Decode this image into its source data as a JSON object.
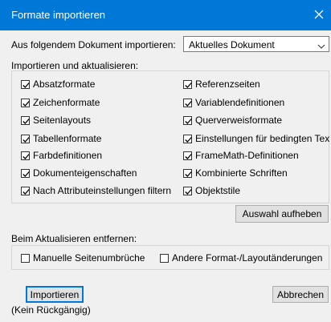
{
  "window": {
    "title": "Formate importieren",
    "accent_color": "#0078d7",
    "close_icon": "close-icon"
  },
  "source": {
    "label": "Aus folgendem Dokument importieren:",
    "selected": "Aktuelles Dokument"
  },
  "import_section": {
    "label": "Importieren und aktualisieren:",
    "left_items": [
      {
        "label": "Absatzformate",
        "checked": true
      },
      {
        "label": "Zeichenformate",
        "checked": true
      },
      {
        "label": "Seitenlayouts",
        "checked": true
      },
      {
        "label": "Tabellenformate",
        "checked": true
      },
      {
        "label": "Farbdefinitionen",
        "checked": true
      },
      {
        "label": "Dokumenteigenschaften",
        "checked": true
      },
      {
        "label": "Nach Attributeinstellungen filtern",
        "checked": true
      }
    ],
    "right_items": [
      {
        "label": "Referenzseiten",
        "checked": true
      },
      {
        "label": "Variablendefinitionen",
        "checked": true
      },
      {
        "label": "Querverweisformate",
        "checked": true
      },
      {
        "label": "Einstellungen für bedingten Tex",
        "checked": true
      },
      {
        "label": "FrameMath-Definitionen",
        "checked": true
      },
      {
        "label": "Kombinierte Schriften",
        "checked": true
      },
      {
        "label": "Objektstile",
        "checked": true
      }
    ],
    "toggle_button": "Auswahl aufheben"
  },
  "remove_section": {
    "label": "Beim Aktualisieren entfernen:",
    "items": [
      {
        "label": "Manuelle Seitenumbrüche",
        "checked": false
      },
      {
        "label": "Andere Format-/Layoutänderungen",
        "checked": false
      }
    ]
  },
  "footer": {
    "import_button": "Importieren",
    "cancel_button": "Abbrechen",
    "note": "(Kein Rückgängig)"
  }
}
